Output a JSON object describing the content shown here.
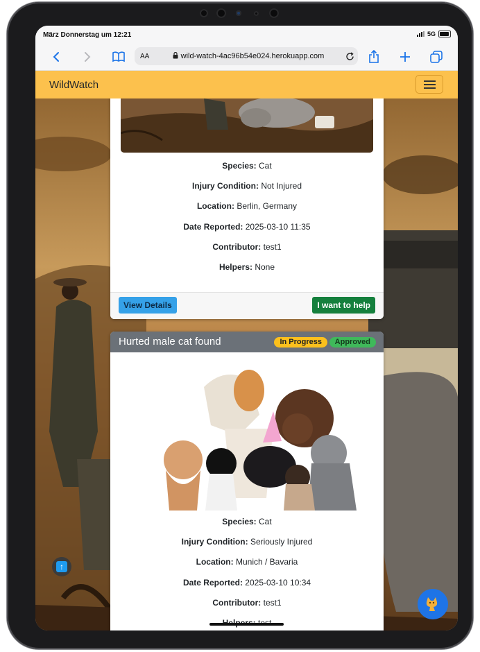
{
  "status": {
    "time": "März Donnerstag um 12:21",
    "network": "5G"
  },
  "browser": {
    "text_size_label": "AA",
    "url": "wild-watch-4ac96b54e024.herokuapp.com",
    "icons": [
      "back-icon",
      "forward-icon",
      "bookmarks-icon",
      "lock-icon",
      "reload-icon",
      "share-icon",
      "new-tab-icon",
      "tabs-icon"
    ]
  },
  "navbar": {
    "brand": "WildWatch",
    "menu_icon": "hamburger-icon"
  },
  "cards": [
    {
      "species_label": "Species:",
      "species": "Cat",
      "injury_label": "Injury Condition:",
      "injury": "Not Injured",
      "location_label": "Location:",
      "location": "Berlin, Germany",
      "date_label": "Date Reported:",
      "date": "2025-03-10 11:35",
      "contributor_label": "Contributor:",
      "contributor": "test1",
      "helpers_label": "Helpers:",
      "helpers": "None",
      "view_details": "View Details",
      "want_to_help": "I want to help"
    },
    {
      "title": "Hurted male cat found",
      "status_badge": "In Progress",
      "approval_badge": "Approved",
      "species_label": "Species:",
      "species": "Cat",
      "injury_label": "Injury Condition:",
      "injury": "Seriously Injured",
      "location_label": "Location:",
      "location": "Munich / Bavaria",
      "date_label": "Date Reported:",
      "date": "2025-03-10 10:34",
      "contributor_label": "Contributor:",
      "contributor": "test1",
      "helpers_label": "Helpers:",
      "helpers": "test"
    }
  ],
  "colors": {
    "navbar": "#fcc14d",
    "view_details": "#35a1e8",
    "want_to_help": "#15803d",
    "badge_in_progress": "#fcc01c",
    "badge_approved": "#3fb95a",
    "card_header": "#6b7178",
    "chat_button": "#1e74e6"
  },
  "floating": {
    "scroll_top_icon": "arrow-up-icon",
    "chat_icon": "cat-icon"
  }
}
